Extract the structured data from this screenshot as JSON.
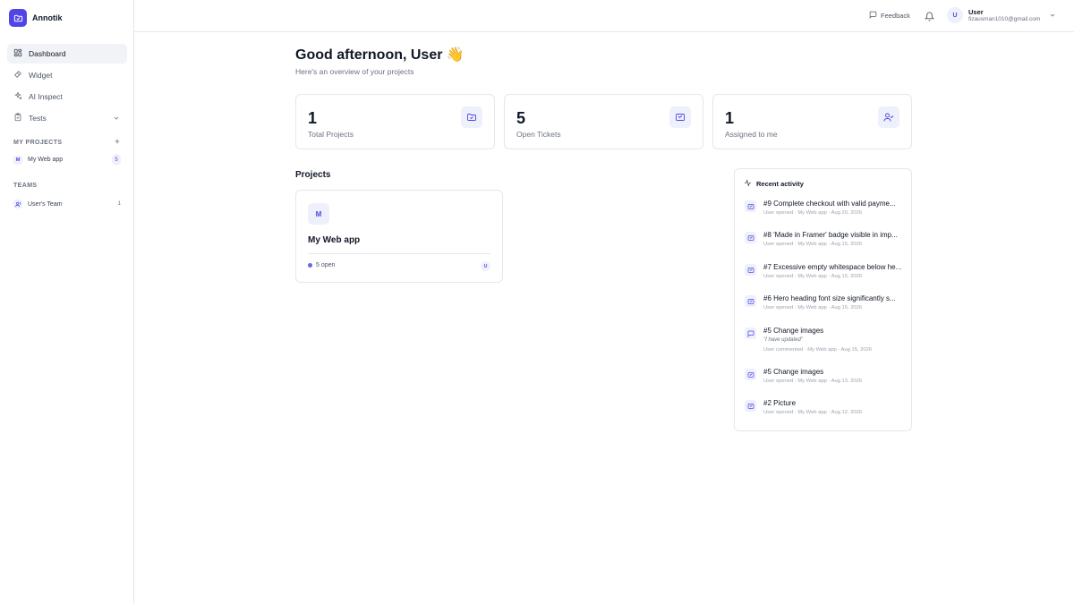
{
  "app": {
    "name": "Annotik"
  },
  "sidebar": {
    "nav": [
      {
        "label": "Dashboard",
        "icon": "dashboard-icon",
        "active": true
      },
      {
        "label": "Widget",
        "icon": "widget-icon"
      },
      {
        "label": "AI Inspect",
        "icon": "sparkles-icon"
      },
      {
        "label": "Tests",
        "icon": "clipboard-icon"
      }
    ],
    "my_projects_heading": "MY PROJECTS",
    "projects": [
      {
        "initial": "M",
        "name": "My Web app",
        "count": "5"
      }
    ],
    "teams_heading": "TEAMS",
    "teams": [
      {
        "name": "User's Team",
        "count": "1"
      }
    ]
  },
  "topbar": {
    "feedback_label": "Feedback",
    "user": {
      "initial": "U",
      "name": "User",
      "email": "fizausman1010@gmail.com"
    }
  },
  "main": {
    "greeting": "Good afternoon, User",
    "greeting_emoji": "👋",
    "subtitle": "Here's an overview of your projects",
    "stats": [
      {
        "value": "1",
        "label": "Total Projects",
        "icon": "folder-icon"
      },
      {
        "value": "5",
        "label": "Open Tickets",
        "icon": "ticket-icon"
      },
      {
        "value": "1",
        "label": "Assigned to me",
        "icon": "user-check-icon"
      }
    ],
    "projects_heading": "Projects",
    "project_card": {
      "initial": "M",
      "name": "My Web app",
      "status": "5 open",
      "member_initial": "U"
    }
  },
  "activity": {
    "heading": "Recent activity",
    "items": [
      {
        "title": "#9 Complete checkout with valid payme...",
        "meta": "User opened · My Web app · Aug 20, 2026",
        "icon": "ticket-icon"
      },
      {
        "title": "#8 'Made in Framer' badge visible in imp...",
        "meta": "User opened · My Web app · Aug 15, 2026",
        "icon": "ticket-icon"
      },
      {
        "title": "#7 Excessive empty whitespace below he...",
        "meta": "User opened · My Web app · Aug 15, 2026",
        "icon": "ticket-icon"
      },
      {
        "title": "#6 Hero heading font size significantly s...",
        "meta": "User opened · My Web app · Aug 15, 2026",
        "icon": "ticket-icon"
      },
      {
        "title": "#5 Change images",
        "quote": "\"I have updated\"",
        "meta": "User commented · My Web app · Aug 15, 2026",
        "icon": "comment-icon"
      },
      {
        "title": "#5 Change images",
        "meta": "User opened · My Web app · Aug 13, 2026",
        "icon": "ticket-icon"
      },
      {
        "title": "#2 Picture",
        "meta": "User opened · My Web app · Aug 12, 2026",
        "icon": "ticket-icon"
      }
    ]
  },
  "colors": {
    "accent": "#4f46e5",
    "accent_soft": "#eef0fb",
    "border": "#e5e7eb",
    "muted": "#6b7280"
  }
}
